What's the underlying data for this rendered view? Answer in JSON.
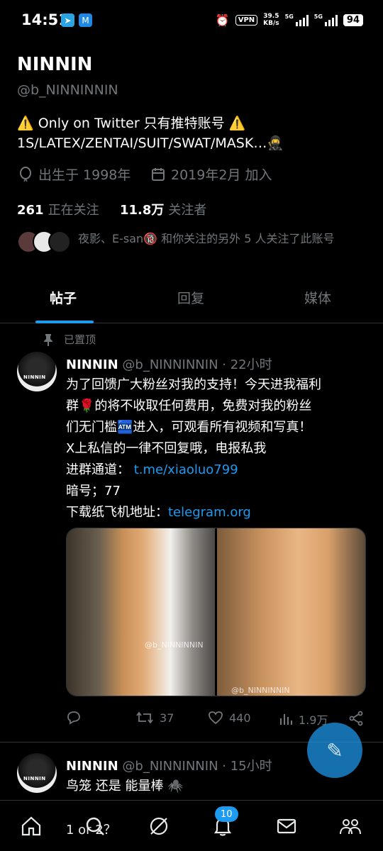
{
  "status_bar": {
    "time": "14:51",
    "vpn": "VPN",
    "speed_value": "39.5",
    "speed_unit": "KB/s",
    "net1": "5G",
    "net2": "5G",
    "battery": "94"
  },
  "profile": {
    "name": "NINNIN",
    "handle": "@b_NINNINNIN",
    "bio_line1": "⚠️ Only on Twitter 只有推特账号 ⚠️",
    "bio_line2": "1S/LATEX/ZENTAI/SUIT/SWAT/MASK…🥷",
    "birth": "出生于 1998年",
    "joined": "2019年2月 加入",
    "following_count": "261",
    "following_label": "正在关注",
    "followers_count": "11.8万",
    "followers_label": "关注者",
    "followed_by": "夜影、E-san🔞 和你关注的另外 5 人关注了此账号"
  },
  "tabs": [
    "帖子",
    "回复",
    "媒体"
  ],
  "pinned_label": "已置顶",
  "tweet1": {
    "name": "NINNIN",
    "handle_time": "@b_NINNINNIN · 22小时",
    "lines": [
      "为了回馈广大粉丝对我的支持！今天进我福利",
      "群🌹的将不收取任何费用，免费对我的粉丝",
      "们无门槛🏧进入，可观看所有视频和写真！",
      "X上私信的一律不回复哦，电报私我"
    ],
    "group_label": "进群通道：",
    "group_link": "t.me/xiaoluo799",
    "code_line": "暗号；77",
    "download_label": "下载纸飞机地址：",
    "download_link": "telegram.org",
    "watermark1": "@b_NINNINNIN",
    "watermark2": "@b_NINNINNIN",
    "retweets": "37",
    "likes": "440",
    "views": "1.9万"
  },
  "tweet2": {
    "name": "NINNIN",
    "handle_time": "@b_NINNINNIN · 15小时",
    "line1": "鸟笼 还是 能量棒 🕷️",
    "line2": "1 or 2？"
  },
  "avatar_text": "NINNIN",
  "nav": {
    "notifications_badge": "10"
  },
  "colors": {
    "accent": "#1d9bf0",
    "muted": "#71767b",
    "background": "#000000"
  }
}
